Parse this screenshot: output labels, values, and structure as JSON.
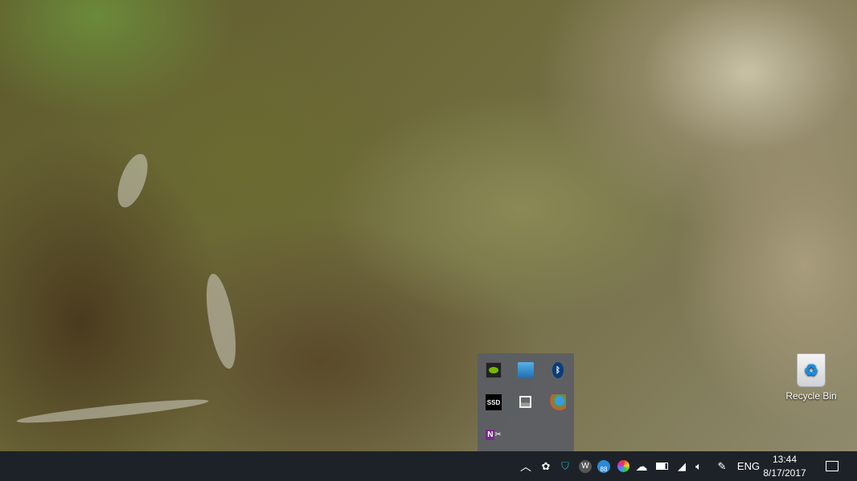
{
  "desktop": {
    "recycle_bin_label": "Recycle Bin"
  },
  "tray_overflow": {
    "icons": [
      "nvidia-icon",
      "intel-graphics-icon",
      "bluetooth-icon",
      "ssd-icon",
      "touchpad-icon",
      "internet-download-manager-icon",
      "onenote-clipper-icon"
    ],
    "ssd_text": "SSD",
    "onenote_text": "N"
  },
  "taskbar": {
    "tray_icons": [
      "show-hidden-icons-chevron",
      "network-sharing-icon",
      "security-shield-icon",
      "w-app-icon",
      "ba-app-icon",
      "color-app-icon",
      "onedrive-icon",
      "battery-icon",
      "wifi-icon",
      "volume-icon",
      "pen-icon"
    ],
    "w_text": "W",
    "ba_text": "88",
    "language": "ENG",
    "time": "13:44",
    "date": "8/17/2017"
  }
}
